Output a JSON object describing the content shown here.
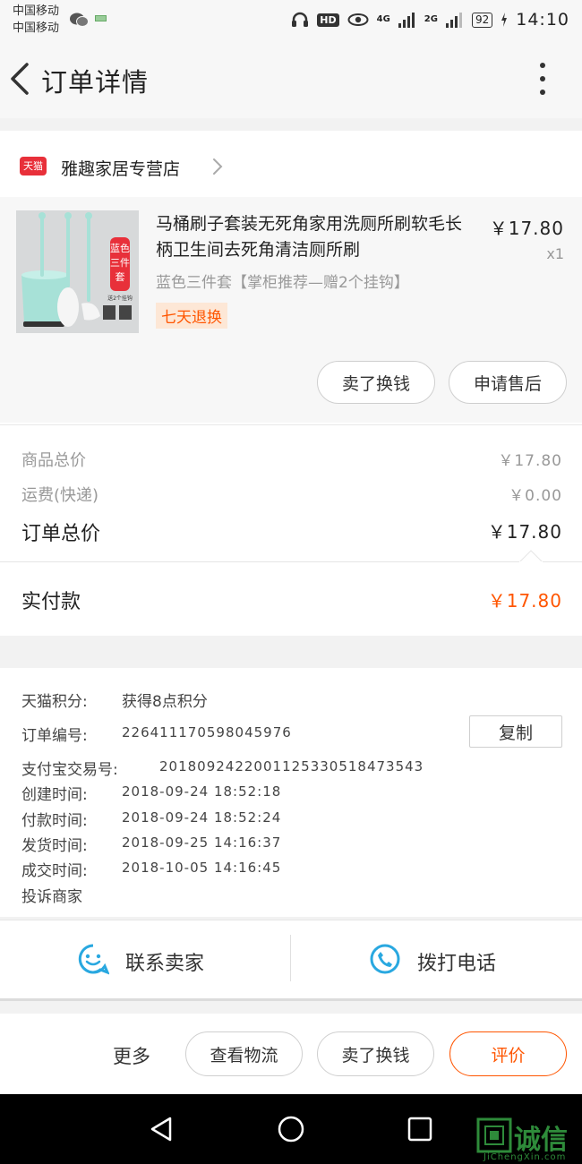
{
  "status_bar": {
    "carrier_1": "中国移动",
    "carrier_2": "中国移动",
    "hd_label": "HD",
    "network_1": "4G",
    "network_2": "2G",
    "battery": "92",
    "time": "14:10"
  },
  "header": {
    "title": "订单详情",
    "back_icon": "chevron-left-icon",
    "more_icon": "vertical-dots-icon"
  },
  "store": {
    "badge": "天猫",
    "name": "雅趣家居专营店"
  },
  "product": {
    "title": "马桶刷子套装无死角家用洗厕所刷软毛长柄卫生间去死角清洁厕所刷",
    "price": "￥17.80",
    "quantity": "x1",
    "sku": "蓝色三件套【掌柜推荐—赠2个挂钩】",
    "service_tag": "七天退换",
    "thumb_label_vertical": "蓝色三件套",
    "thumb_label_small": "送2个挂钩"
  },
  "actions": {
    "resell": "卖了换钱",
    "after_sale": "申请售后"
  },
  "fees": {
    "goods_total_label": "商品总价",
    "goods_total_value": "￥17.80",
    "shipping_label": "运费(快递)",
    "shipping_value": "￥0.00",
    "order_total_label": "订单总价",
    "order_total_value": "￥17.80",
    "paid_label": "实付款",
    "paid_value": "￥17.80"
  },
  "order_info": {
    "points_label": "天猫积分:",
    "points_value": "获得8点积分",
    "order_no_label": "订单编号:",
    "order_no_value": "226411170598045976",
    "copy_button": "复制",
    "alipay_label": "支付宝交易号:",
    "alipay_value": "2018092422001125330518473543",
    "created_label": "创建时间:",
    "created_value": "2018-09-24 18:52:18",
    "paid_time_label": "付款时间:",
    "paid_time_value": "2018-09-24 18:52:24",
    "shipped_label": "发货时间:",
    "shipped_value": "2018-09-25 14:16:37",
    "completed_label": "成交时间:",
    "completed_value": "2018-10-05 14:16:45",
    "complaint": "投诉商家"
  },
  "contact": {
    "seller": "联系卖家",
    "call": "拨打电话"
  },
  "bottom_actions": {
    "more": "更多",
    "logistics": "查看物流",
    "resell": "卖了换钱",
    "review": "评价"
  },
  "colors": {
    "accent": "#ff5500",
    "tmall_red": "#e8303a",
    "icon_blue": "#29a8e0"
  },
  "watermark": {
    "text": "诚信",
    "url_text": "JiChengXin.com"
  }
}
